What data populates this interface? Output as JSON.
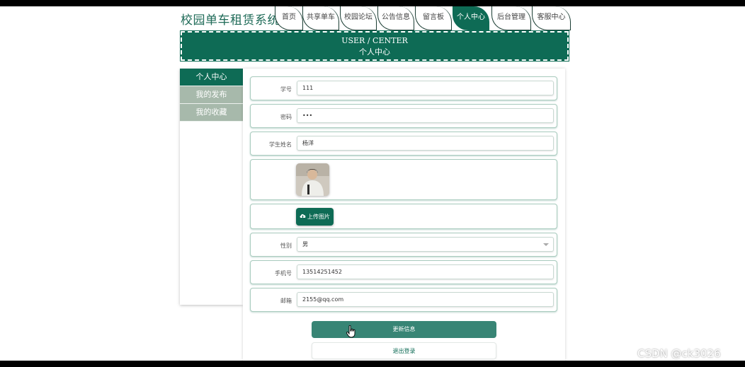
{
  "site": {
    "title": "校园单车租赁系统"
  },
  "nav": {
    "items": [
      {
        "label": "首页"
      },
      {
        "label": "共享单车"
      },
      {
        "label": "校园论坛"
      },
      {
        "label": "公告信息"
      },
      {
        "label": "留言板"
      },
      {
        "label": "个人中心",
        "active": true
      },
      {
        "label": "后台管理"
      },
      {
        "label": "客服中心"
      }
    ]
  },
  "banner": {
    "en": "USER / CENTER",
    "cn": "个人中心"
  },
  "sidebar": {
    "items": [
      {
        "label": "个人中心",
        "active": true
      },
      {
        "label": "我的发布"
      },
      {
        "label": "我的收藏"
      }
    ]
  },
  "form": {
    "student_id": {
      "label": "学号",
      "value": "111"
    },
    "password": {
      "label": "密码",
      "value": "•••"
    },
    "student_name": {
      "label": "学生姓名",
      "value": "杨洋"
    },
    "upload_label": "上传图片",
    "gender": {
      "label": "性别",
      "value": "男"
    },
    "phone": {
      "label": "手机号",
      "value": "13514251452"
    },
    "email": {
      "label": "邮箱",
      "value": "2155@qq.com"
    }
  },
  "actions": {
    "update": "更新信息",
    "logout": "退出登录"
  },
  "watermark": "CSDN @ck3026",
  "colors": {
    "primary": "#0e6b55",
    "sidebar_inactive": "#a7b9ab",
    "update_button": "#388575"
  },
  "icons": {
    "upload": "cloud-upload-icon",
    "cursor": "hand-pointer-icon",
    "select": "chevron-down-icon"
  }
}
